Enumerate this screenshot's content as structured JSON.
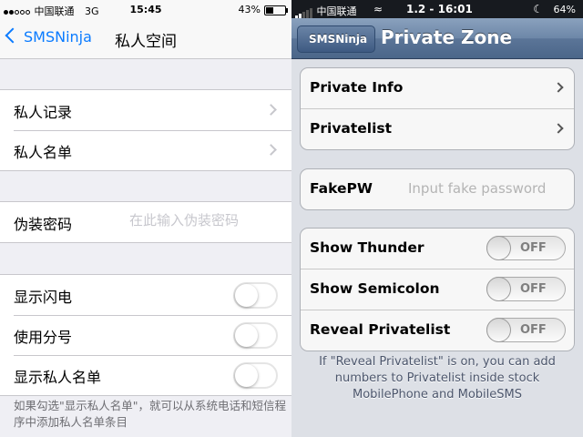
{
  "left": {
    "status": {
      "carrier": "中国联通",
      "network": "3G",
      "time": "15:45",
      "battery": "43%",
      "battery_level": 0.43,
      "signal_filled": 2,
      "signal_total": 5
    },
    "nav": {
      "back_label": "SMSNinja",
      "title": "私人空间"
    },
    "nav_rows": [
      {
        "label": "私人记录"
      },
      {
        "label": "私人名单"
      }
    ],
    "password": {
      "label": "伪装密码",
      "placeholder": "在此输入伪装密码"
    },
    "toggles": [
      {
        "label": "显示闪电",
        "on": false
      },
      {
        "label": "使用分号",
        "on": false
      },
      {
        "label": "显示私人名单",
        "on": false
      }
    ],
    "footer": "如果勾选\"显示私人名单\"，就可以从系统电话和短信程序中添加私人名单条目",
    "accent": "#0a7bff"
  },
  "right": {
    "status": {
      "carrier": "中国联通",
      "time": "1.2 - 16:01",
      "battery": "64%"
    },
    "nav": {
      "back_label": "SMSNinja",
      "title": "Private Zone"
    },
    "nav_rows": [
      {
        "label": "Private Info"
      },
      {
        "label": "Privatelist"
      }
    ],
    "password": {
      "label": "FakePW",
      "placeholder": "Input fake password"
    },
    "toggles": [
      {
        "label": "Show Thunder",
        "state": "OFF"
      },
      {
        "label": "Show Semicolon",
        "state": "OFF"
      },
      {
        "label": "Reveal Privatelist",
        "state": "OFF"
      }
    ],
    "footer": "If \"Reveal Privatelist\" is on, you can add numbers to Privatelist inside stock MobilePhone and MobileSMS",
    "nav_color": "#6d87a8"
  }
}
